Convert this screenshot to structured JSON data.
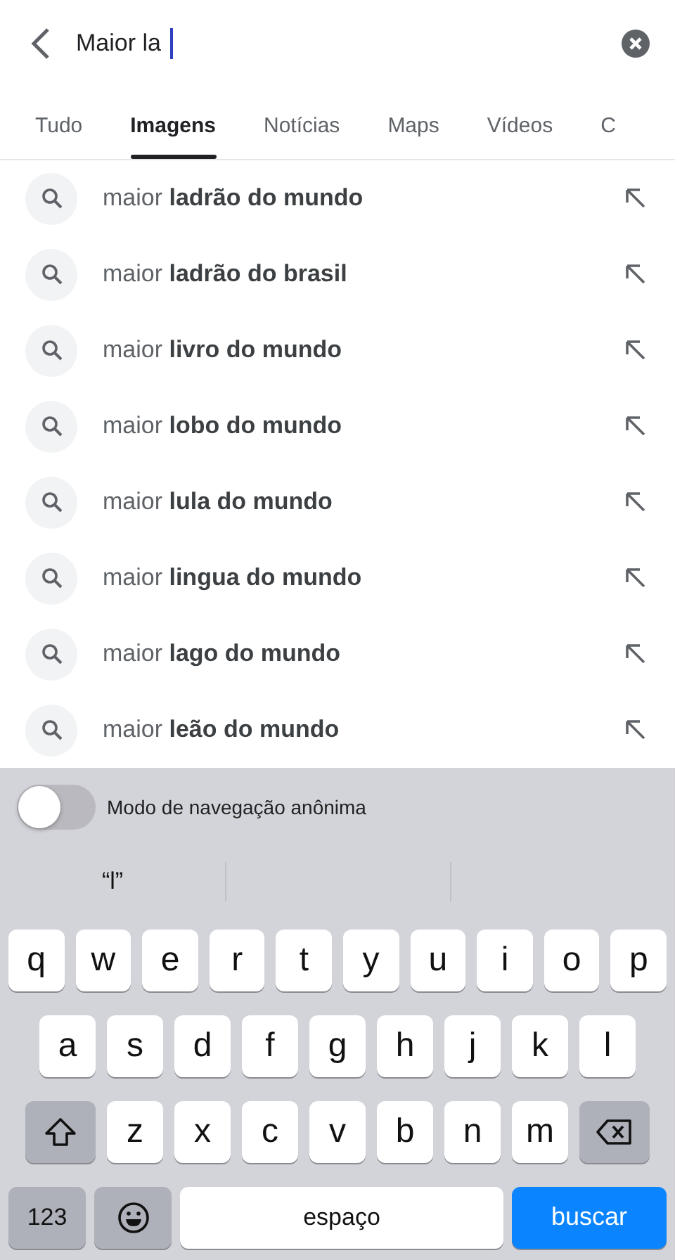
{
  "search": {
    "value": "Maior la"
  },
  "tabs": [
    {
      "label": "Tudo",
      "selected": false
    },
    {
      "label": "Imagens",
      "selected": true
    },
    {
      "label": "Notícias",
      "selected": false
    },
    {
      "label": "Maps",
      "selected": false
    },
    {
      "label": "Vídeos",
      "selected": false
    },
    {
      "label": "C",
      "selected": false
    }
  ],
  "suggestions": [
    "maior **ladrão do mundo**",
    "maior **ladrão do brasil**",
    "maior **livro do mundo**",
    "maior **lobo do mundo**",
    "maior **lula do mundo**",
    "maior **lingua do mundo**",
    "maior **lago do mundo**",
    "maior **leão do mundo**"
  ],
  "incognito": {
    "label": "Modo de navegação anônima",
    "on": false
  },
  "predictions": [
    "“l”"
  ],
  "keyboard": [
    [
      {
        "kind": "char",
        "label": "q"
      },
      {
        "kind": "char",
        "label": "w"
      },
      {
        "kind": "char",
        "label": "e"
      },
      {
        "kind": "char",
        "label": "r"
      },
      {
        "kind": "char",
        "label": "t"
      },
      {
        "kind": "char",
        "label": "y"
      },
      {
        "kind": "char",
        "label": "u"
      },
      {
        "kind": "char",
        "label": "i"
      },
      {
        "kind": "char",
        "label": "o"
      },
      {
        "kind": "char",
        "label": "p"
      }
    ],
    [
      {
        "kind": "char",
        "label": "a"
      },
      {
        "kind": "char",
        "label": "s"
      },
      {
        "kind": "char",
        "label": "d"
      },
      {
        "kind": "char",
        "label": "f"
      },
      {
        "kind": "char",
        "label": "g"
      },
      {
        "kind": "char",
        "label": "h"
      },
      {
        "kind": "char",
        "label": "j"
      },
      {
        "kind": "char",
        "label": "k"
      },
      {
        "kind": "char",
        "label": "l"
      }
    ],
    [
      {
        "kind": "shift"
      },
      {
        "kind": "char",
        "label": "z"
      },
      {
        "kind": "char",
        "label": "x"
      },
      {
        "kind": "char",
        "label": "c"
      },
      {
        "kind": "char",
        "label": "v"
      },
      {
        "kind": "char",
        "label": "b"
      },
      {
        "kind": "char",
        "label": "n"
      },
      {
        "kind": "char",
        "label": "m"
      },
      {
        "kind": "backspace"
      }
    ],
    [
      {
        "kind": "numbers",
        "label": "123"
      },
      {
        "kind": "emoji"
      },
      {
        "kind": "space",
        "label": "espaço"
      },
      {
        "kind": "go",
        "label": "buscar"
      }
    ]
  ]
}
